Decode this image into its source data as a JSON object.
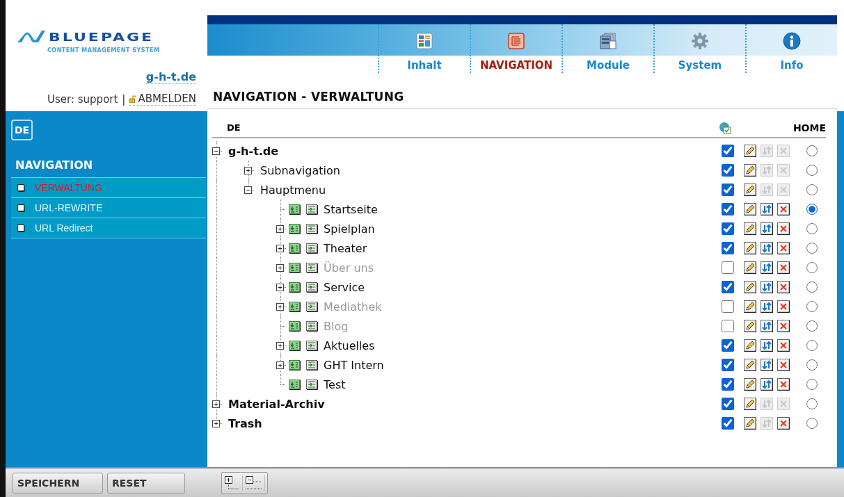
{
  "logo": {
    "name": "BLUEPAGE",
    "tagline": "CONTENT MANAGEMENT SYSTEM"
  },
  "site": "g-h-t.de",
  "user": {
    "label": "User: support",
    "separator": "|",
    "logout": "ABMELDEN"
  },
  "language": "DE",
  "sidebar": {
    "title": "NAVIGATION",
    "items": [
      {
        "label": "VERWALTUNG",
        "selected": true
      },
      {
        "label": "URL-REWRITE",
        "selected": false
      },
      {
        "label": "URL Redirect",
        "selected": false
      }
    ]
  },
  "tabs": [
    {
      "label": "Inhalt",
      "selected": false
    },
    {
      "label": "NAVIGATION",
      "selected": true
    },
    {
      "label": "Module",
      "selected": false
    },
    {
      "label": "System",
      "selected": false
    },
    {
      "label": "Info",
      "selected": false
    }
  ],
  "page_title": "NAVIGATION - VERWALTUNG",
  "tree": {
    "language": "DE",
    "home": "HOME",
    "nodes": [
      {
        "label": "g-h-t.de",
        "kind": "root",
        "has_children": true,
        "expanded": true,
        "visible": true,
        "movable": false,
        "deletable": false,
        "selected": false,
        "children": [
          {
            "label": "Subnavigation",
            "kind": "section",
            "has_children": true,
            "expanded": false,
            "visible": true,
            "movable": false,
            "deletable": false,
            "selected": false
          },
          {
            "label": "Hauptmenu",
            "kind": "section",
            "has_children": true,
            "expanded": true,
            "visible": true,
            "movable": false,
            "deletable": false,
            "selected": false,
            "children": [
              {
                "label": "Startseite",
                "kind": "page",
                "has_children": false,
                "visible": true,
                "movable": true,
                "deletable": true,
                "selected": true
              },
              {
                "label": "Spielplan",
                "kind": "page",
                "has_children": true,
                "expanded": false,
                "visible": true,
                "movable": true,
                "deletable": true,
                "selected": false
              },
              {
                "label": "Theater",
                "kind": "page",
                "has_children": true,
                "expanded": false,
                "visible": true,
                "movable": true,
                "deletable": true,
                "selected": false
              },
              {
                "label": "Über uns",
                "kind": "page",
                "has_children": true,
                "expanded": false,
                "visible": false,
                "movable": true,
                "deletable": true,
                "selected": false
              },
              {
                "label": "Service",
                "kind": "page",
                "has_children": true,
                "expanded": false,
                "visible": true,
                "movable": true,
                "deletable": true,
                "selected": false
              },
              {
                "label": "Mediathek",
                "kind": "page",
                "has_children": true,
                "expanded": false,
                "visible": false,
                "movable": true,
                "deletable": true,
                "selected": false
              },
              {
                "label": "Blog",
                "kind": "page",
                "has_children": false,
                "visible": false,
                "movable": true,
                "deletable": true,
                "selected": false
              },
              {
                "label": "Aktuelles",
                "kind": "page",
                "has_children": true,
                "expanded": false,
                "visible": true,
                "movable": true,
                "deletable": true,
                "selected": false
              },
              {
                "label": "GHT Intern",
                "kind": "page",
                "has_children": true,
                "expanded": false,
                "visible": true,
                "movable": true,
                "deletable": true,
                "selected": false
              },
              {
                "label": "Test",
                "kind": "page",
                "has_children": false,
                "visible": true,
                "movable": true,
                "deletable": true,
                "selected": false
              }
            ]
          }
        ]
      },
      {
        "label": "Material-Archiv",
        "kind": "root",
        "has_children": true,
        "expanded": false,
        "visible": true,
        "movable": false,
        "deletable": false,
        "selected": false
      },
      {
        "label": "Trash",
        "kind": "root",
        "has_children": true,
        "expanded": false,
        "visible": true,
        "movable": false,
        "deletable": true,
        "selected": false
      }
    ]
  },
  "footer": {
    "buttons": [
      "SPEICHERN",
      "RESET"
    ]
  }
}
